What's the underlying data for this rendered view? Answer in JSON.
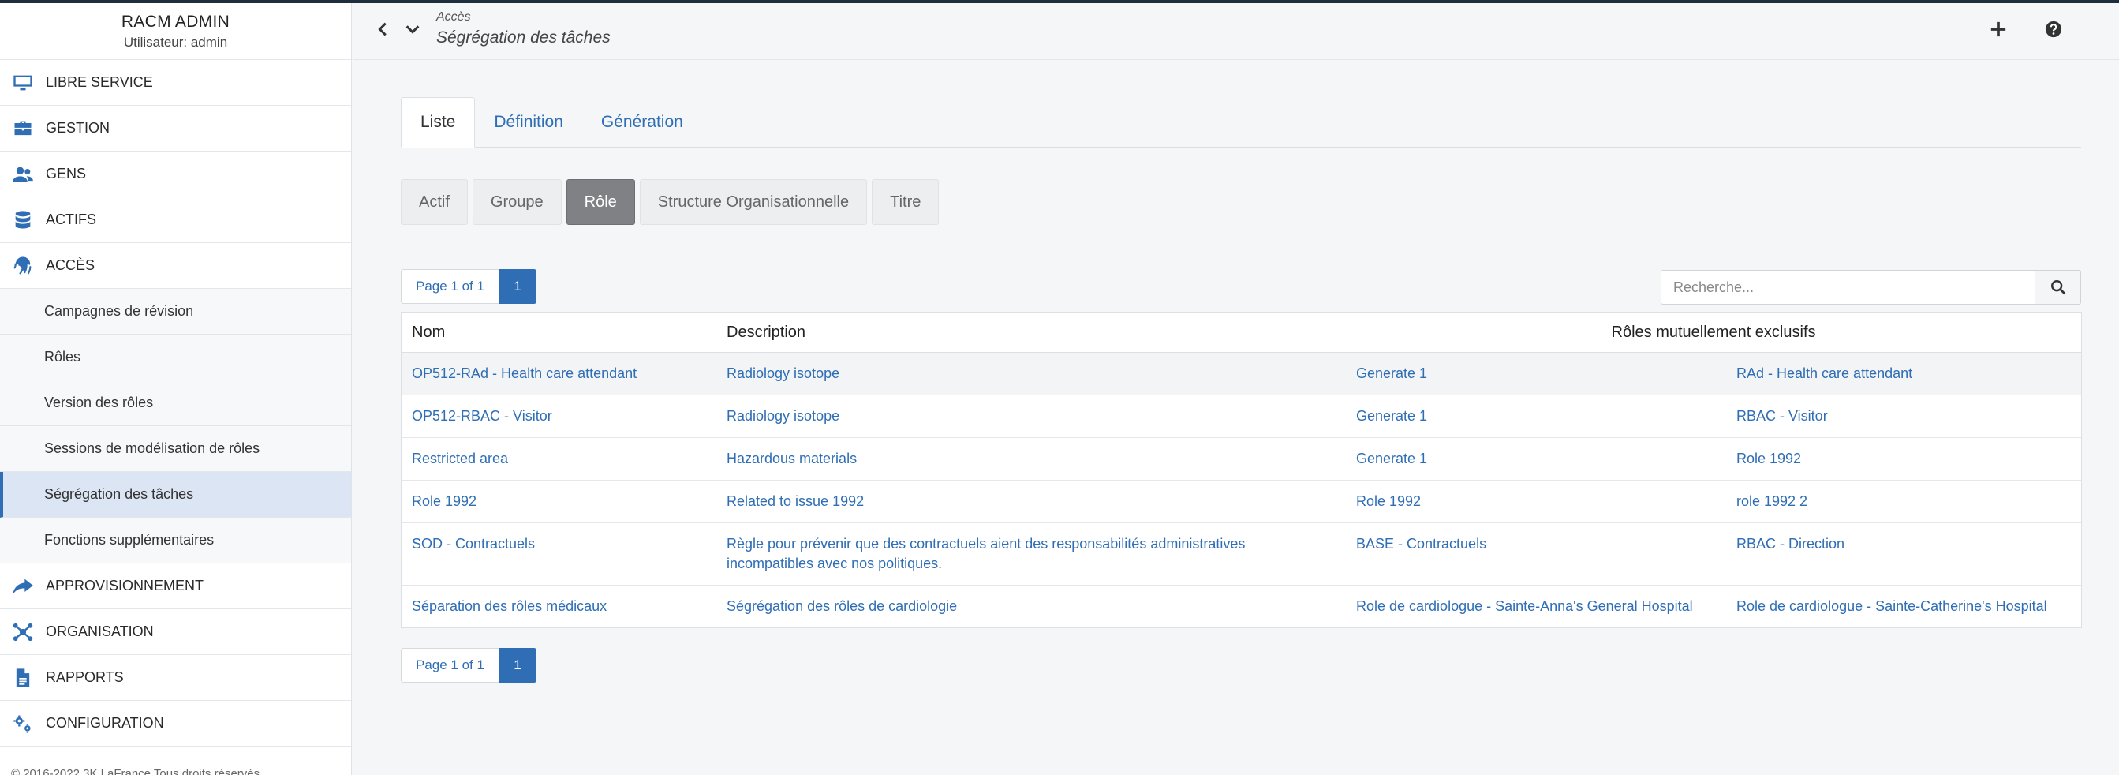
{
  "app": {
    "title": "RACM ADMIN",
    "user": "Utilisateur: admin"
  },
  "sidebar": {
    "items": [
      {
        "label": "LIBRE SERVICE"
      },
      {
        "label": "GESTION"
      },
      {
        "label": "GENS"
      },
      {
        "label": "ACTIFS"
      },
      {
        "label": "ACCÈS"
      }
    ],
    "sub_items": [
      {
        "label": "Campagnes de révision"
      },
      {
        "label": "Rôles"
      },
      {
        "label": "Version des rôles"
      },
      {
        "label": "Sessions de modélisation de rôles"
      },
      {
        "label": "Ségrégation des tâches"
      },
      {
        "label": "Fonctions supplémentaires"
      }
    ],
    "items_after": [
      {
        "label": "APPROVISIONNEMENT"
      },
      {
        "label": "ORGANISATION"
      },
      {
        "label": "RAPPORTS"
      },
      {
        "label": "CONFIGURATION"
      }
    ],
    "footer": "© 2016-2022 3K LaFrance Tous droits réservés"
  },
  "header": {
    "breadcrumb_parent": "Accès",
    "page_title": "Ségrégation des tâches"
  },
  "tabs": [
    {
      "label": "Liste"
    },
    {
      "label": "Définition"
    },
    {
      "label": "Génération"
    }
  ],
  "pills": [
    {
      "label": "Actif"
    },
    {
      "label": "Groupe"
    },
    {
      "label": "Rôle"
    },
    {
      "label": "Structure Organisationnelle"
    },
    {
      "label": "Titre"
    }
  ],
  "pager": {
    "info": "Page 1 of 1",
    "page": "1"
  },
  "search": {
    "placeholder": "Recherche..."
  },
  "table": {
    "headers": {
      "nom": "Nom",
      "description": "Description",
      "roles": "Rôles mutuellement exclusifs"
    },
    "rows": [
      {
        "nom": "OP512-RAd - Health care attendant",
        "description": "Radiology isotope",
        "role_a": "Generate 1",
        "role_b": "RAd - Health care attendant"
      },
      {
        "nom": "OP512-RBAC - Visitor",
        "description": "Radiology isotope",
        "role_a": "Generate 1",
        "role_b": "RBAC - Visitor"
      },
      {
        "nom": "Restricted area",
        "description": "Hazardous materials",
        "role_a": "Generate 1",
        "role_b": "Role 1992"
      },
      {
        "nom": "Role 1992",
        "description": "Related to issue 1992",
        "role_a": "Role 1992",
        "role_b": "role 1992 2"
      },
      {
        "nom": "SOD - Contractuels",
        "description": "Règle pour prévenir que des contractuels aient des responsabilités administratives incompatibles avec nos politiques.",
        "role_a": "BASE - Contractuels",
        "role_b": "RBAC - Direction"
      },
      {
        "nom": "Séparation des rôles médicaux",
        "description": "Ségrégation des rôles de cardiologie",
        "role_a": "Role de cardiologue - Sainte-Anna's General Hospital",
        "role_b": "Role de cardiologue - Sainte-Catherine's Hospital"
      }
    ]
  },
  "colors": {
    "accent": "#2f6eb5",
    "active_pill": "#7f8184",
    "active_sidebar": "#dbe5f3"
  }
}
